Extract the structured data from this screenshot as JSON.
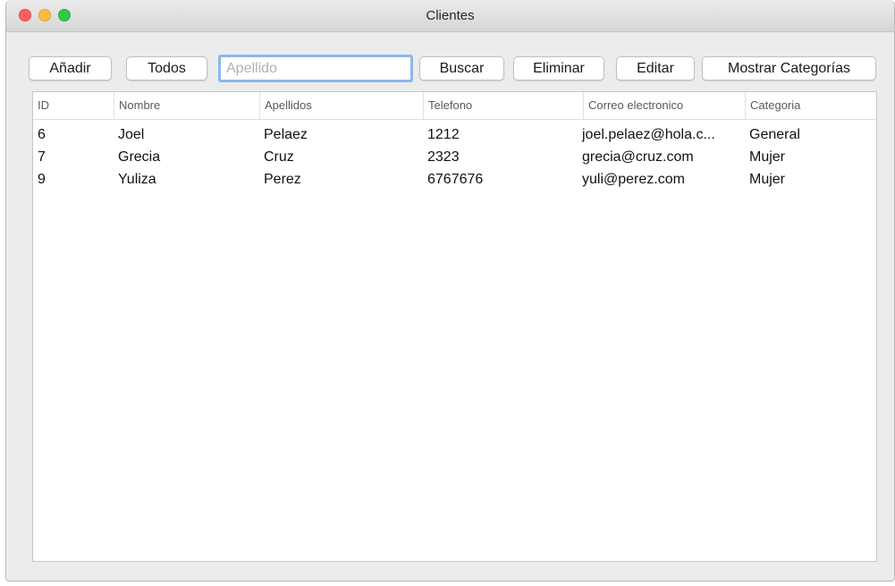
{
  "window": {
    "title": "Clientes"
  },
  "toolbar": {
    "add_label": "Añadir",
    "all_label": "Todos",
    "search_placeholder": "Apellido",
    "search_value": "",
    "search_button_label": "Buscar",
    "delete_label": "Eliminar",
    "edit_label": "Editar",
    "categories_label": "Mostrar Categorías"
  },
  "table": {
    "columns": [
      "ID",
      "Nombre",
      "Apellidos",
      "Telefono",
      "Correo electronico",
      "Categoria"
    ],
    "rows": [
      [
        "6",
        "Joel",
        "Pelaez",
        "1212",
        "joel.pelaez@hola.c...",
        "General"
      ],
      [
        "7",
        "Grecia",
        "Cruz",
        "2323",
        "grecia@cruz.com",
        "Mujer"
      ],
      [
        "9",
        "Yuliza",
        "Perez",
        "6767676",
        "yuli@perez.com",
        "Mujer"
      ]
    ]
  },
  "colors": {
    "close": "#fc605c",
    "minimize": "#fdbc40",
    "zoom": "#34c84a",
    "focus_ring": "#8cb7ea"
  }
}
